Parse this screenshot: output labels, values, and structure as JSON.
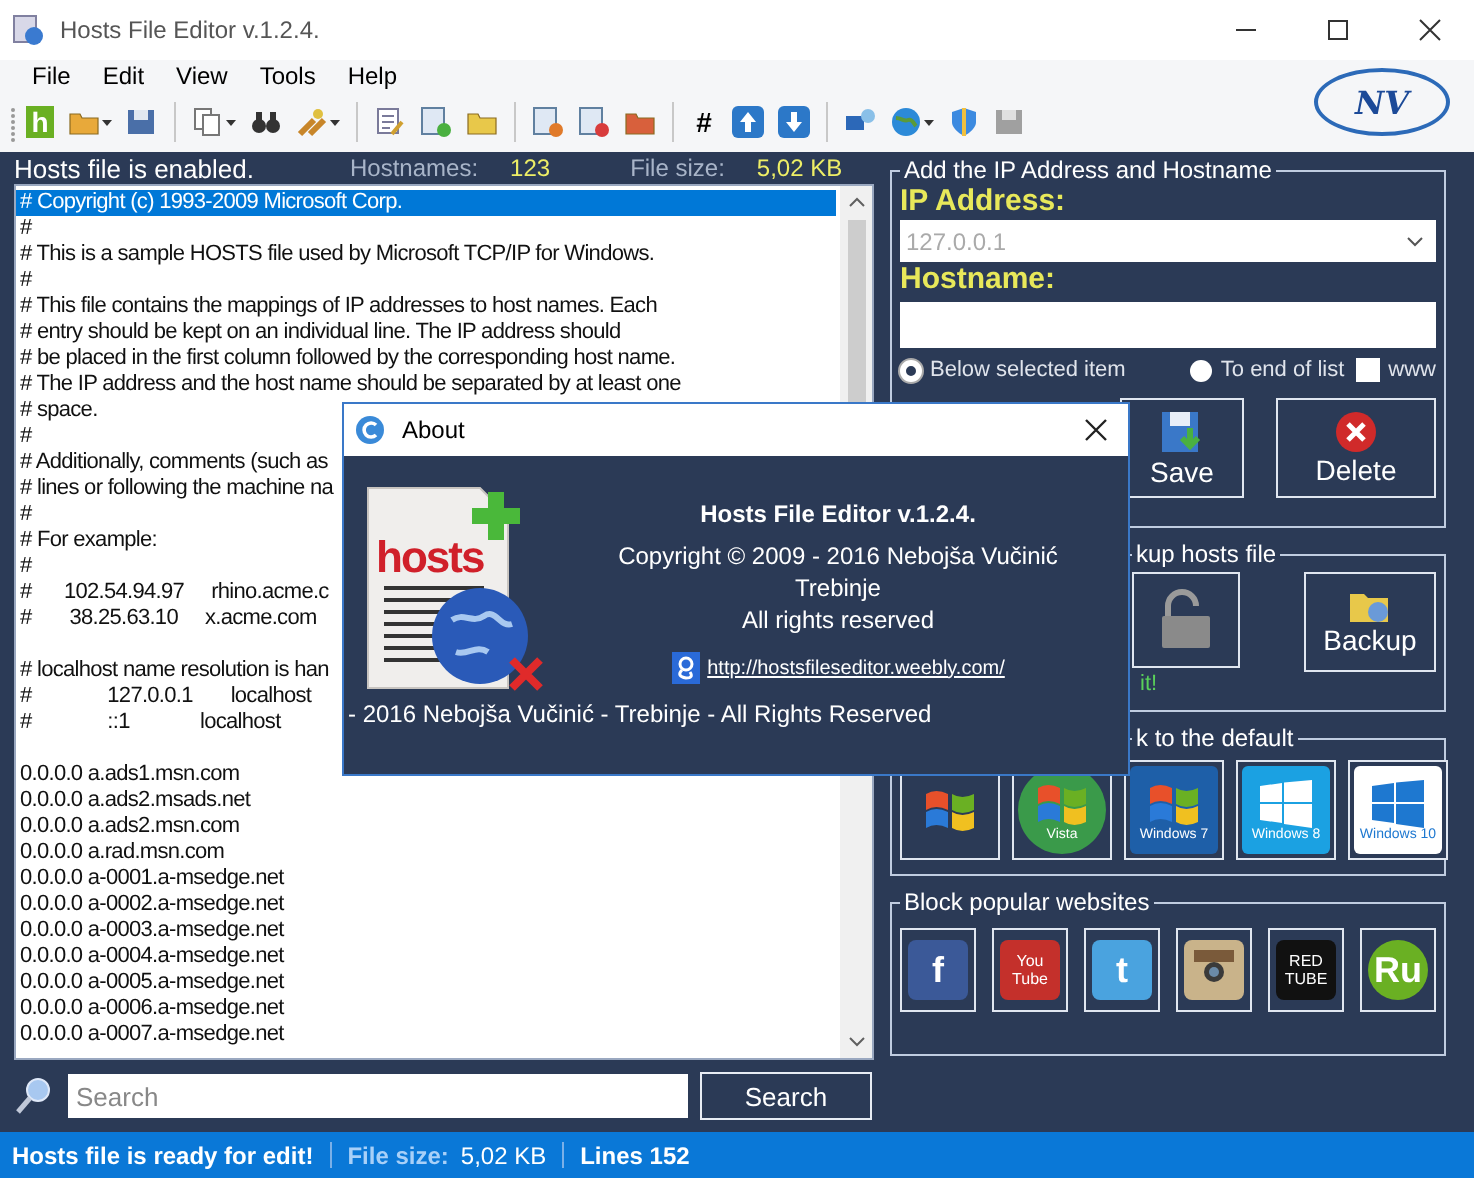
{
  "window": {
    "title": "Hosts File Editor v.1.2.4."
  },
  "menu": [
    "File",
    "Edit",
    "View",
    "Tools",
    "Help"
  ],
  "toolbar": [
    [
      {
        "kind": "app-glyph",
        "text": "h",
        "dropdown": false
      },
      {
        "kind": "folder-open",
        "dropdown": true
      },
      {
        "kind": "save",
        "dropdown": false
      }
    ],
    [
      {
        "kind": "copy",
        "dropdown": true
      },
      {
        "kind": "find",
        "dropdown": false
      },
      {
        "kind": "tools",
        "dropdown": true
      }
    ],
    [
      {
        "kind": "edit",
        "dropdown": false
      },
      {
        "kind": "page-add",
        "dropdown": false
      },
      {
        "kind": "folder-add",
        "dropdown": false
      }
    ],
    [
      {
        "kind": "page-cut",
        "dropdown": false
      },
      {
        "kind": "page-remove",
        "dropdown": false
      },
      {
        "kind": "folder-remove",
        "dropdown": false
      }
    ],
    [
      {
        "kind": "glyph",
        "text": "#",
        "dropdown": false
      },
      {
        "kind": "arrow-up",
        "dropdown": false
      },
      {
        "kind": "arrow-down",
        "dropdown": false
      }
    ],
    [
      {
        "kind": "network",
        "dropdown": false
      },
      {
        "kind": "globe",
        "dropdown": true
      },
      {
        "kind": "shield",
        "dropdown": false
      },
      {
        "kind": "disk",
        "dropdown": false
      }
    ]
  ],
  "logo": "NV",
  "status_line": {
    "message": "Hosts file is enabled.",
    "hostnames_label": "Hostnames:",
    "hostnames": "123",
    "size_label": "File size:",
    "size": "5,02 KB"
  },
  "editor": {
    "lines": [
      {
        "text": "# Copyright (c) 1993-2009 Microsoft Corp.",
        "selected": true,
        "gap_before": false
      },
      {
        "text": "#",
        "selected": false,
        "gap_before": false
      },
      {
        "text": "# This is a sample HOSTS file used by Microsoft TCP/IP for Windows.",
        "selected": false,
        "gap_before": false
      },
      {
        "text": "#",
        "selected": false,
        "gap_before": false
      },
      {
        "text": "# This file contains the mappings of IP addresses to host names. Each",
        "selected": false,
        "gap_before": false
      },
      {
        "text": "# entry should be kept on an individual line. The IP address should",
        "selected": false,
        "gap_before": false
      },
      {
        "text": "# be placed in the first column followed by the corresponding host name.",
        "selected": false,
        "gap_before": false
      },
      {
        "text": "# The IP address and the host name should be separated by at least one",
        "selected": false,
        "gap_before": false
      },
      {
        "text": "# space.",
        "selected": false,
        "gap_before": false
      },
      {
        "text": "#",
        "selected": false,
        "gap_before": false
      },
      {
        "text": "# Additionally, comments (such as",
        "selected": false,
        "gap_before": false
      },
      {
        "text": "# lines or following the machine na",
        "selected": false,
        "gap_before": false
      },
      {
        "text": "#",
        "selected": false,
        "gap_before": false
      },
      {
        "text": "# For example:",
        "selected": false,
        "gap_before": false
      },
      {
        "text": "#",
        "selected": false,
        "gap_before": false
      },
      {
        "text": "#      102.54.94.97     rhino.acme.c",
        "selected": false,
        "gap_before": false
      },
      {
        "text": "#       38.25.63.10     x.acme.com",
        "selected": false,
        "gap_before": false
      },
      {
        "text": "# localhost name resolution is han",
        "selected": false,
        "gap_before": true
      },
      {
        "text": "#              127.0.0.1       localhost",
        "selected": false,
        "gap_before": false
      },
      {
        "text": "#              ::1             localhost",
        "selected": false,
        "gap_before": false
      },
      {
        "text": "0.0.0.0 a.ads1.msn.com",
        "selected": false,
        "gap_before": true
      },
      {
        "text": "0.0.0.0 a.ads2.msads.net",
        "selected": false,
        "gap_before": false
      },
      {
        "text": "0.0.0.0 a.ads2.msn.com",
        "selected": false,
        "gap_before": false
      },
      {
        "text": "0.0.0.0 a.rad.msn.com",
        "selected": false,
        "gap_before": false
      },
      {
        "text": "0.0.0.0 a-0001.a-msedge.net",
        "selected": false,
        "gap_before": false
      },
      {
        "text": "0.0.0.0 a-0002.a-msedge.net",
        "selected": false,
        "gap_before": false
      },
      {
        "text": "0.0.0.0 a-0003.a-msedge.net",
        "selected": false,
        "gap_before": false
      },
      {
        "text": "0.0.0.0 a-0004.a-msedge.net",
        "selected": false,
        "gap_before": false
      },
      {
        "text": "0.0.0.0 a-0005.a-msedge.net",
        "selected": false,
        "gap_before": false
      },
      {
        "text": "0.0.0.0 a-0006.a-msedge.net",
        "selected": false,
        "gap_before": false
      },
      {
        "text": "0.0.0.0 a-0007.a-msedge.net",
        "selected": false,
        "gap_before": false
      }
    ]
  },
  "search": {
    "placeholder": "Search",
    "button": "Search"
  },
  "add_group": {
    "title": "Add the IP Address  and Hostname",
    "ip_label": "IP Address:",
    "ip_placeholder": "127.0.0.1",
    "hostname_label": "Hostname:",
    "options": [
      {
        "kind": "radio",
        "label": "Below selected item",
        "selected": true
      },
      {
        "kind": "radio",
        "label": "To end of list",
        "selected": false
      },
      {
        "kind": "checkbox",
        "label": "www",
        "selected": false
      }
    ],
    "buttons": [
      {
        "kind": "save",
        "label": "Save"
      },
      {
        "kind": "delete",
        "label": "Delete"
      }
    ]
  },
  "backup_group": {
    "title": "kup hosts file",
    "buttons": [
      {
        "kind": "lock"
      },
      {
        "kind": "backup",
        "label": "Backup"
      }
    ],
    "note": "it!"
  },
  "restore_group": {
    "title": "k to the default",
    "items": [
      {
        "kind": "flag",
        "color": "#2b3a56"
      },
      {
        "kind": "flag-round",
        "label": "Vista",
        "color": "#3a9a4a"
      },
      {
        "kind": "flag",
        "label": "Windows 7",
        "color": "#1e5fa8"
      },
      {
        "kind": "tile",
        "label": "Windows 8",
        "color": "#1ba1e2"
      },
      {
        "kind": "tile",
        "label": "Windows 10",
        "color": "#ffffff"
      }
    ]
  },
  "block_group": {
    "title": "Block popular websites",
    "sites": [
      {
        "kind": "square",
        "lines": [
          "f"
        ],
        "color": "#3b5998"
      },
      {
        "kind": "square",
        "lines": [
          "You",
          "Tube"
        ],
        "color": "#c4302b"
      },
      {
        "kind": "square",
        "lines": [
          "t"
        ],
        "color": "#4aa3df"
      },
      {
        "kind": "camera",
        "color": "#c9b38a"
      },
      {
        "kind": "square",
        "lines": [
          "RED",
          "TUBE"
        ],
        "color": "#111111"
      },
      {
        "kind": "round",
        "lines": [
          "Ru"
        ],
        "color": "#6ab023"
      }
    ]
  },
  "about": {
    "title": "About",
    "logo_text": "hosts",
    "heading": "Hosts File Editor v.1.2.4.",
    "copyright": "Copyright © 2009 - 2016 Nebojša Vučinić",
    "city": "Trebinje",
    "rights": "All rights reserved",
    "link": "http://hostsfileseditor.weebly.com/",
    "footer": "- 2016  Nebojša Vučinić - Trebinje - All Rights Reserved"
  },
  "status_bar": {
    "message": "Hosts file is ready for edit!",
    "size_label": "File size:",
    "size": "5,02 KB",
    "lines": "Lines 152"
  }
}
